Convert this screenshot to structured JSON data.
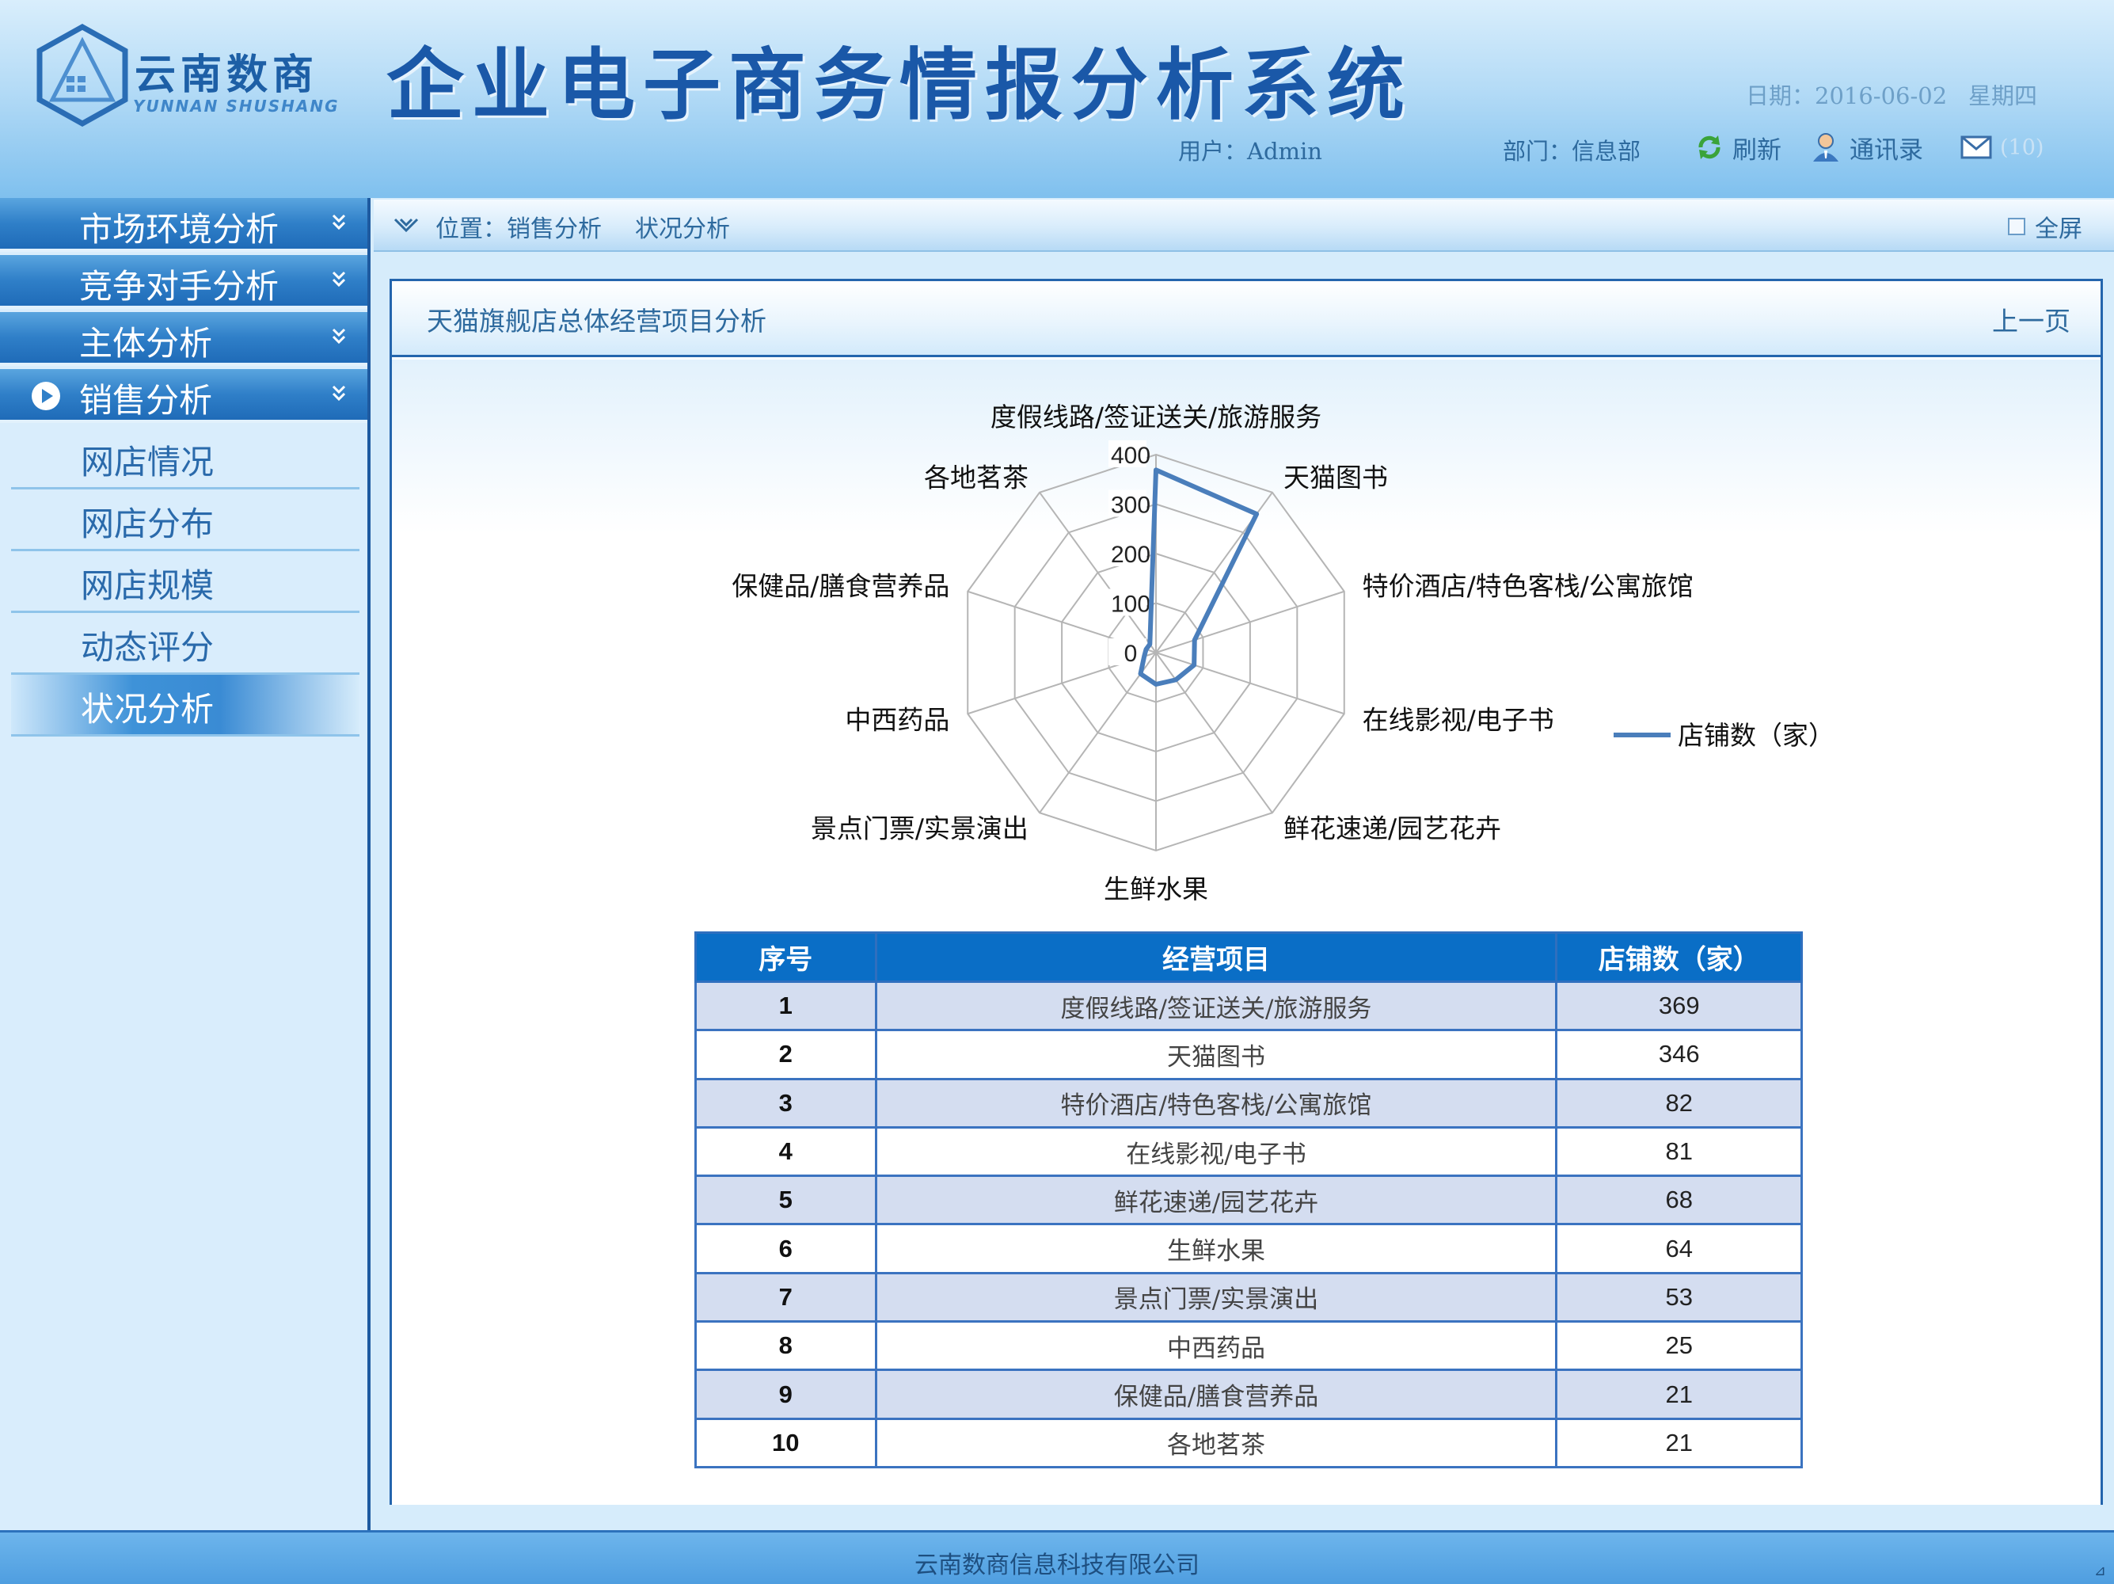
{
  "header": {
    "logo_cn": "云南数商",
    "logo_en": "YUNNAN SHUSHANG",
    "system_title": "企业电子商务情报分析系统",
    "date": "日期：2016-06-02",
    "weekday": "星期四",
    "user": "用户：Admin",
    "dept": "部门：信息部",
    "refresh": "刷新",
    "contacts": "通讯录",
    "mail_count": "(10)"
  },
  "sidebar": {
    "categories": [
      {
        "label": "市场环境分析"
      },
      {
        "label": "竞争对手分析"
      },
      {
        "label": "主体分析"
      },
      {
        "label": "销售分析"
      }
    ],
    "sub_items": [
      {
        "label": "网店情况"
      },
      {
        "label": "网店分布"
      },
      {
        "label": "网店规模"
      },
      {
        "label": "动态评分"
      },
      {
        "label": "状况分析"
      }
    ]
  },
  "location": {
    "prefix": "位置：销售分析",
    "current": "状况分析",
    "fullscreen": "全屏"
  },
  "panel": {
    "title": "天猫旗舰店总体经营项目分析",
    "prev_page": "上一页"
  },
  "chart_data": {
    "type": "radar",
    "categories": [
      "度假线路/签证送关/旅游服务",
      "天猫图书",
      "特价酒店/特色客栈/公寓旅馆",
      "在线影视/电子书",
      "鲜花速递/园艺花卉",
      "生鲜水果",
      "景点门票/实景演出",
      "中西药品",
      "保健品/膳食营养品",
      "各地茗茶"
    ],
    "series": [
      {
        "name": "店铺数（家）",
        "values": [
          369,
          346,
          82,
          81,
          68,
          64,
          53,
          25,
          21,
          21
        ]
      }
    ],
    "ticks": [
      "0",
      "100",
      "200",
      "300",
      "400"
    ],
    "rmax": 400,
    "legend": "right",
    "grid": true,
    "series_color": "#4a7ebb"
  },
  "table": {
    "headers": [
      "序号",
      "经营项目",
      "店铺数（家）"
    ],
    "rows": [
      {
        "idx": "1",
        "item": "度假线路/签证送关/旅游服务",
        "count": "369"
      },
      {
        "idx": "2",
        "item": "天猫图书",
        "count": "346"
      },
      {
        "idx": "3",
        "item": "特价酒店/特色客栈/公寓旅馆",
        "count": "82"
      },
      {
        "idx": "4",
        "item": "在线影视/电子书",
        "count": "81"
      },
      {
        "idx": "5",
        "item": "鲜花速递/园艺花卉",
        "count": "68"
      },
      {
        "idx": "6",
        "item": "生鲜水果",
        "count": "64"
      },
      {
        "idx": "7",
        "item": "景点门票/实景演出",
        "count": "53"
      },
      {
        "idx": "8",
        "item": "中西药品",
        "count": "25"
      },
      {
        "idx": "9",
        "item": "保健品/膳食营养品",
        "count": "21"
      },
      {
        "idx": "10",
        "item": "各地茗茶",
        "count": "21"
      }
    ]
  },
  "footer": {
    "company": "云南数商信息科技有限公司"
  }
}
